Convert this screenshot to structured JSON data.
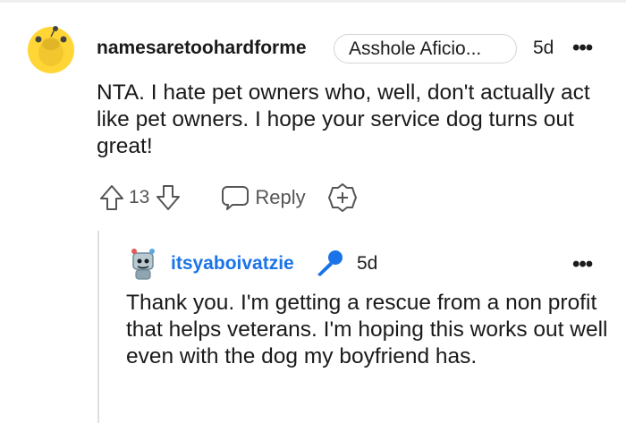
{
  "comment": {
    "username": "namesaretoohardforme",
    "flair": "Asshole Aficio...",
    "time": "5d",
    "more": "•••",
    "body": "NTA. I hate pet owners who, well, don't actually act like pet owners. I hope your service dog turns out great!",
    "score": "13",
    "reply_label": "Reply",
    "icons": {
      "avatar": "reddit-snoo-avatar",
      "upvote": "upvote-arrow-icon",
      "downvote": "downvote-arrow-icon",
      "reply": "speech-bubble-icon",
      "award": "plus-award-icon"
    }
  },
  "reply": {
    "username": "itsyaboivatzie",
    "time": "5d",
    "more": "•••",
    "body": "Thank you. I'm getting a rescue from a non profit that helps veterans. I'm hoping this works out well even with the dog my boyfriend has.",
    "icons": {
      "avatar": "robot-avatar",
      "op_badge": "microphone-icon"
    }
  },
  "colors": {
    "username_op": "#1b73e8",
    "avatar_bg": "#ffd635",
    "mic": "#1b73e8"
  }
}
